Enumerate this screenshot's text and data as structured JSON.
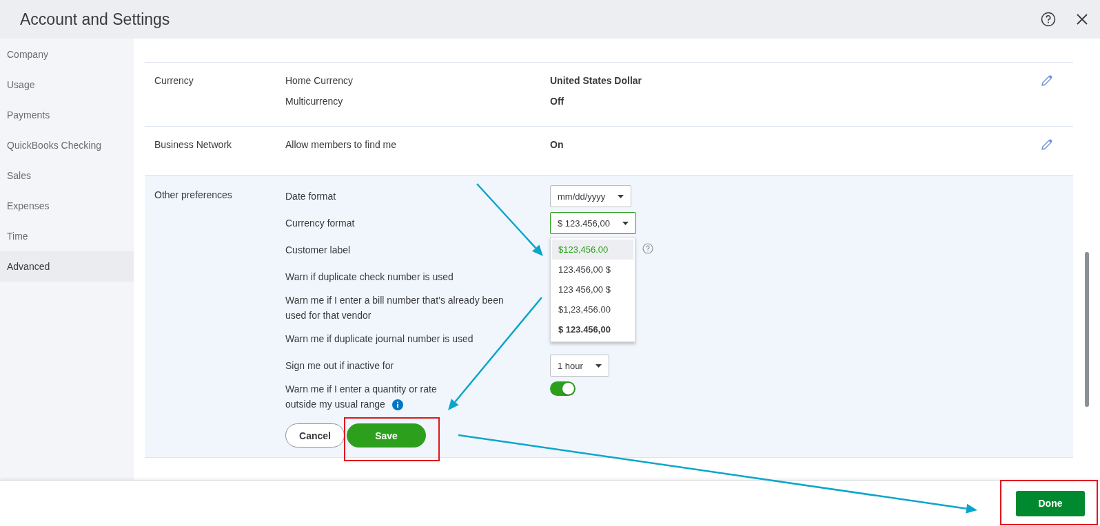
{
  "window": {
    "title": "Account and Settings"
  },
  "sidebar": {
    "items": [
      {
        "label": "Company",
        "selected": false
      },
      {
        "label": "Usage",
        "selected": false
      },
      {
        "label": "Payments",
        "selected": false
      },
      {
        "label": "QuickBooks Checking",
        "selected": false
      },
      {
        "label": "Sales",
        "selected": false
      },
      {
        "label": "Expenses",
        "selected": false
      },
      {
        "label": "Time",
        "selected": false
      },
      {
        "label": "Advanced",
        "selected": true
      }
    ]
  },
  "sections": [
    {
      "title": "Currency",
      "editable": true,
      "rows": [
        {
          "label": "Home Currency",
          "value": "United States Dollar"
        },
        {
          "label": "Multicurrency",
          "value": "Off"
        }
      ]
    },
    {
      "title": "Business Network",
      "editable": true,
      "rows": [
        {
          "label": "Allow members to find me",
          "value": "On"
        }
      ]
    }
  ],
  "other_preferences": {
    "title": "Other preferences",
    "rows": [
      {
        "kind": "select",
        "label": "Date format",
        "value": "mm/dd/yyyy",
        "focused": false
      },
      {
        "kind": "select",
        "label": "Currency format",
        "value": "$ 123.456,00",
        "focused": true,
        "options": [
          {
            "label": "$123,456.00",
            "highlighted": true,
            "selected": false
          },
          {
            "label": "123.456,00 $",
            "highlighted": false,
            "selected": false
          },
          {
            "label": "123 456,00 $",
            "highlighted": false,
            "selected": false
          },
          {
            "label": "$1,23,456.00",
            "highlighted": false,
            "selected": false
          },
          {
            "label": "$ 123.456,00",
            "highlighted": false,
            "selected": true
          }
        ]
      },
      {
        "kind": "help",
        "label": "Customer label"
      },
      {
        "kind": "text",
        "label": "Warn if duplicate check number is used"
      },
      {
        "kind": "text",
        "label": "Warn me if I enter a bill number that’s already been used for that vendor"
      },
      {
        "kind": "text",
        "label": "Warn me if duplicate journal number is used"
      },
      {
        "kind": "select",
        "label": "Sign me out if inactive for",
        "value": "1 hour",
        "focused": false
      },
      {
        "kind": "toggle",
        "label": "Warn me if I enter a quantity or rate outside my usual range",
        "on": true
      }
    ],
    "cancel": "Cancel",
    "save": "Save"
  },
  "footer": {
    "done": "Done"
  }
}
